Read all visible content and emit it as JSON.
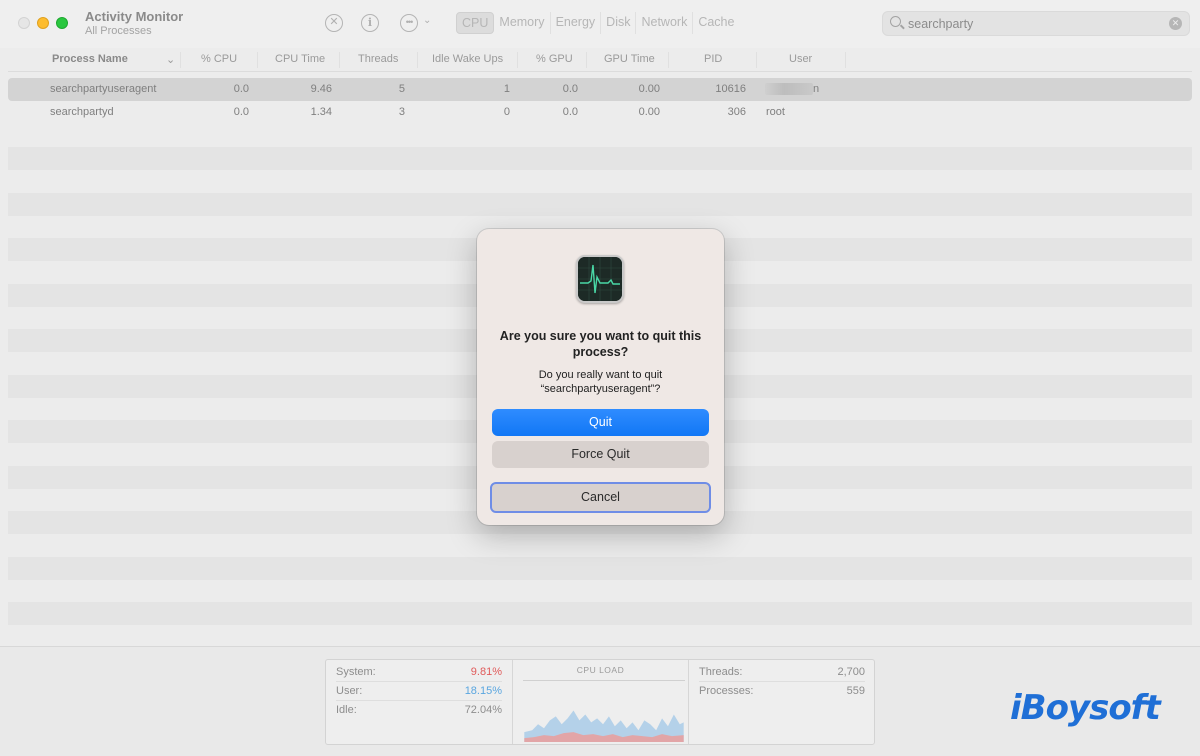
{
  "window": {
    "title": "Activity Monitor",
    "subtitle": "All Processes"
  },
  "toolbar": {
    "stop_icon": "x-circle-icon",
    "info_icon": "info-circle-icon",
    "more_icon": "ellipsis-circle-icon",
    "tabs": [
      {
        "label": "CPU",
        "active": true
      },
      {
        "label": "Memory",
        "active": false
      },
      {
        "label": "Energy",
        "active": false
      },
      {
        "label": "Disk",
        "active": false
      },
      {
        "label": "Network",
        "active": false
      },
      {
        "label": "Cache",
        "active": false
      }
    ],
    "search": {
      "value": "searchparty",
      "placeholder": "Search"
    }
  },
  "table": {
    "columns": [
      "Process Name",
      "% CPU",
      "CPU Time",
      "Threads",
      "Idle Wake Ups",
      "% GPU",
      "GPU Time",
      "PID",
      "User"
    ],
    "rows": [
      {
        "name": "searchpartyuseragent",
        "cpu": "0.0",
        "cpu_time": "9.46",
        "threads": "5",
        "idle_wake": "1",
        "gpu": "0.0",
        "gpu_time": "0.00",
        "pid": "10616",
        "user": "n",
        "selected": true
      },
      {
        "name": "searchpartyd",
        "cpu": "0.0",
        "cpu_time": "1.34",
        "threads": "3",
        "idle_wake": "0",
        "gpu": "0.0",
        "gpu_time": "0.00",
        "pid": "306",
        "user": "root",
        "selected": false
      }
    ]
  },
  "footer": {
    "system_label": "System:",
    "system_value": "9.81%",
    "system_color": "#e05b5b",
    "user_label": "User:",
    "user_value": "18.15%",
    "user_color": "#5aa6e0",
    "idle_label": "Idle:",
    "idle_value": "72.04%",
    "cpu_load_title": "CPU LOAD",
    "threads_label": "Threads:",
    "threads_value": "2,700",
    "processes_label": "Processes:",
    "processes_value": "559"
  },
  "dialog": {
    "icon": "activity-monitor-app-icon",
    "title": "Are you sure you want to quit this process?",
    "message": "Do you really want to quit “searchpartyuseragent”?",
    "quit_label": "Quit",
    "force_quit_label": "Force Quit",
    "cancel_label": "Cancel",
    "accent_color": "#1a7ff9"
  },
  "watermark": "iBoysoft"
}
